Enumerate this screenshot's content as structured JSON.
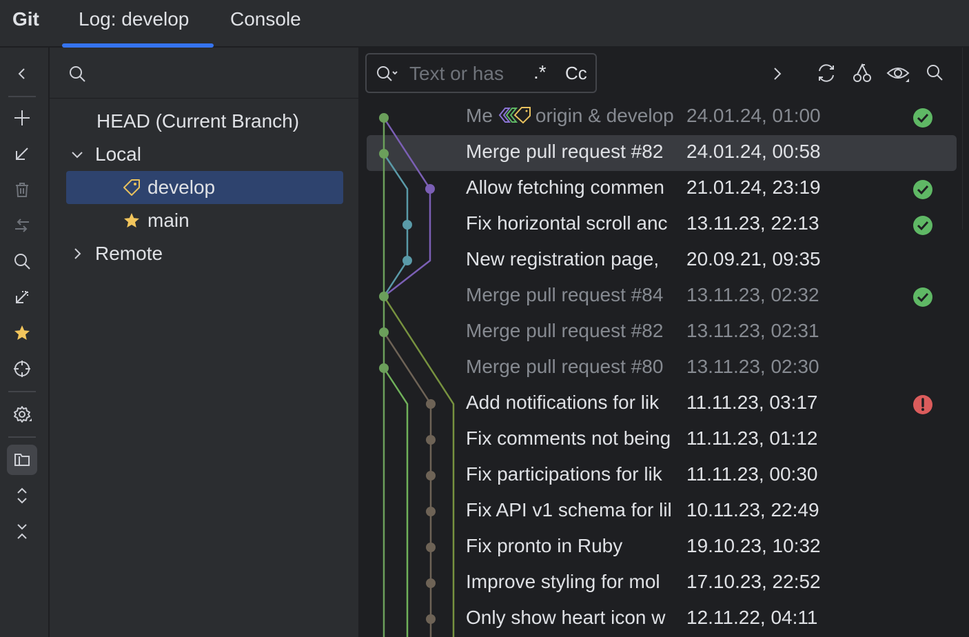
{
  "header": {
    "app_title": "Git",
    "tabs": [
      {
        "label": "Log: develop",
        "active": true
      },
      {
        "label": "Console",
        "active": false
      }
    ],
    "accent_color": "#3574f0"
  },
  "toolbar": {
    "items": [
      "collapse-icon",
      "plus-icon",
      "arrow-down-left-icon",
      "trash-icon",
      "merge-arrows-icon",
      "search-icon",
      "diff-arrow-icon",
      "star-icon",
      "target-icon",
      "gear-icon",
      "branches-panel-icon",
      "expand-icon",
      "collapse-all-icon"
    ]
  },
  "branches": {
    "search_placeholder": "",
    "head_label": "HEAD (Current Branch)",
    "local_label": "Local",
    "local_branches": [
      {
        "name": "develop",
        "icon": "tag-icon",
        "selected": true
      },
      {
        "name": "main",
        "icon": "star-icon",
        "selected": false
      }
    ],
    "remote_label": "Remote"
  },
  "log": {
    "filter_placeholder": "Text or has",
    "regex_label": ".*",
    "case_label": "Cc",
    "first_row_refs": "origin & develop",
    "commits": [
      {
        "subject": "Me",
        "date": "24.01.24, 01:00",
        "status": "success",
        "dim": true,
        "selected": false
      },
      {
        "subject": "Merge pull request #82",
        "date": "24.01.24, 00:58",
        "status": "none",
        "dim": false,
        "selected": true
      },
      {
        "subject": "Allow fetching commen",
        "date": "21.01.24, 23:19",
        "status": "success",
        "dim": false,
        "selected": false
      },
      {
        "subject": "Fix horizontal scroll anc",
        "date": "13.11.23, 22:13",
        "status": "success",
        "dim": false,
        "selected": false
      },
      {
        "subject": "New registration page,",
        "date": "20.09.21, 09:35",
        "status": "none",
        "dim": false,
        "selected": false
      },
      {
        "subject": "Merge pull request #84",
        "date": "13.11.23, 02:32",
        "status": "success",
        "dim": true,
        "selected": false
      },
      {
        "subject": "Merge pull request #82",
        "date": "13.11.23, 02:31",
        "status": "none",
        "dim": true,
        "selected": false
      },
      {
        "subject": "Merge pull request #80",
        "date": "13.11.23, 02:30",
        "status": "none",
        "dim": true,
        "selected": false
      },
      {
        "subject": "Add notifications for lik",
        "date": "11.11.23, 03:17",
        "status": "error",
        "dim": false,
        "selected": false
      },
      {
        "subject": "Fix comments not being",
        "date": "11.11.23, 01:12",
        "status": "none",
        "dim": false,
        "selected": false
      },
      {
        "subject": "Fix participations for lik",
        "date": "11.11.23, 00:30",
        "status": "none",
        "dim": false,
        "selected": false
      },
      {
        "subject": "Fix API v1 schema for lil",
        "date": "10.11.23, 22:49",
        "status": "none",
        "dim": false,
        "selected": false
      },
      {
        "subject": "Fix pronto in Ruby",
        "date": "19.10.23, 10:32",
        "status": "none",
        "dim": false,
        "selected": false
      },
      {
        "subject": "Improve styling for mol",
        "date": "17.10.23, 22:52",
        "status": "none",
        "dim": false,
        "selected": false
      },
      {
        "subject": "Only show heart icon w",
        "date": "12.11.22, 04:11",
        "status": "none",
        "dim": false,
        "selected": false
      }
    ],
    "colors": {
      "success": "#5fb865",
      "error": "#db5c5c",
      "graph_green": "#6b9f5b",
      "graph_purple": "#7b5fb5",
      "graph_teal": "#5a9aa8",
      "graph_brown": "#6e6356",
      "graph_olive": "#77923f",
      "graph_lime": "#70b15a"
    }
  }
}
